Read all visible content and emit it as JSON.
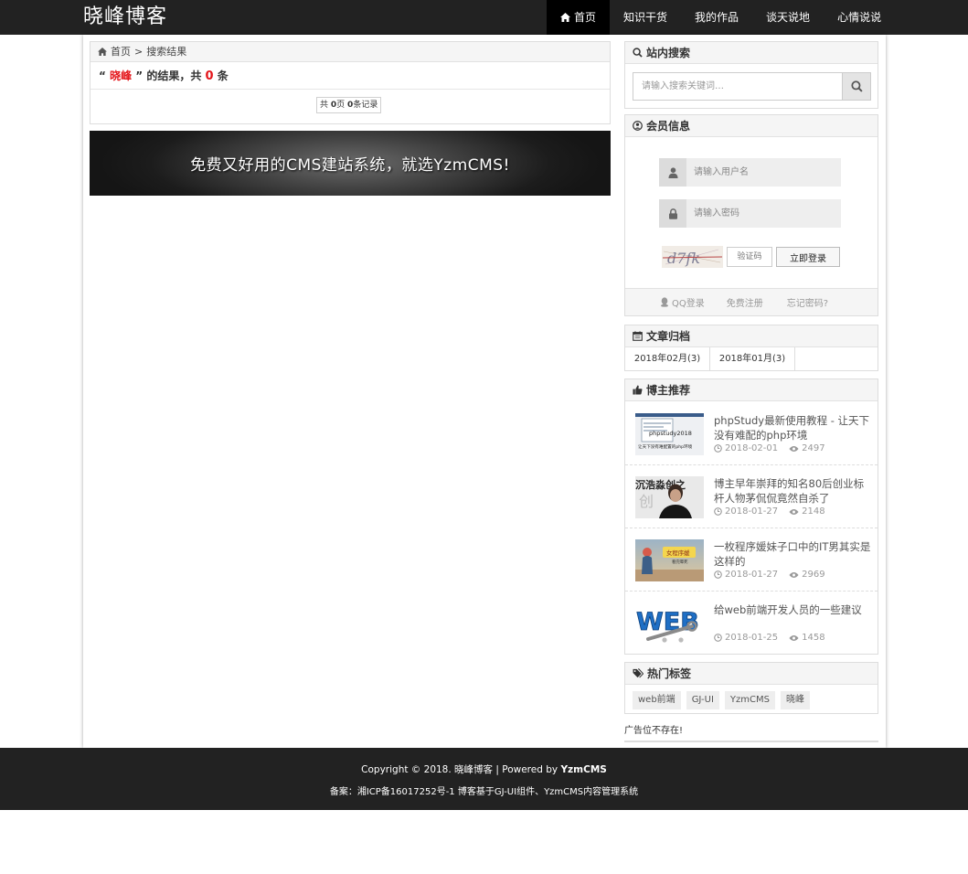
{
  "header": {
    "logo": "晓峰博客",
    "nav": [
      {
        "label": "首页",
        "active": true
      },
      {
        "label": "知识干货",
        "active": false
      },
      {
        "label": "我的作品",
        "active": false
      },
      {
        "label": "谈天说地",
        "active": false
      },
      {
        "label": "心情说说",
        "active": false
      }
    ]
  },
  "breadcrumb": {
    "home": "首页",
    "separator": ">",
    "current": "搜索结果"
  },
  "result": {
    "open_quote": "“",
    "keyword": "晓峰",
    "close_quote": "”",
    "text": " 的结果，共",
    "count": "0",
    "unit": "条"
  },
  "pager": {
    "prefix": "共",
    "pages": "0",
    "mid": "页",
    "records": "0",
    "suffix": "条记录"
  },
  "banner": {
    "text": "免费又好用的CMS建站系统，就选YzmCMS!"
  },
  "site_search": {
    "title": "站内搜索",
    "placeholder": "请输入搜索关键词…"
  },
  "member": {
    "title": "会员信息",
    "username_placeholder": "请输入用户名",
    "password_placeholder": "请输入密码",
    "captcha_placeholder": "验证码",
    "captcha_text": "d7fk",
    "login_label": "立即登录",
    "qq_login": "QQ登录",
    "register": "免费注册",
    "forgot": "忘记密码?"
  },
  "archive": {
    "title": "文章归档",
    "items": [
      "2018年02月(3)",
      "2018年01月(3)"
    ]
  },
  "recommend": {
    "title": "博主推荐",
    "items": [
      {
        "title": "phpStudy最新使用教程 - 让天下没有难配的php环境",
        "date": "2018-02-01",
        "views": "2497",
        "thumb_text": "phpstudy2018",
        "thumb_sub": "让天下没有难配置的php环境"
      },
      {
        "title": "博主早年崇拜的知名80后创业标杆人物茅侃侃竟然自杀了",
        "date": "2018-01-27",
        "views": "2148",
        "thumb_text": "沉浩淼创之",
        "thumb_sub": "创"
      },
      {
        "title": "一枚程序媛妹子口中的IT男其实是这样的",
        "date": "2018-01-27",
        "views": "2969",
        "thumb_text": "女程序媛",
        "thumb_sub": "看完晕死"
      },
      {
        "title": "给web前端开发人员的一些建议",
        "date": "2018-01-25",
        "views": "1458",
        "thumb_text": "WEB",
        "thumb_sub": ""
      }
    ]
  },
  "tags": {
    "title": "热门标签",
    "items": [
      "web前端",
      "GJ-UI",
      "YzmCMS",
      "晓峰"
    ]
  },
  "ad": {
    "text": "广告位不存在!"
  },
  "footer": {
    "copyright": "Copyright © 2018. 晓峰博客 | Powered by",
    "powered": "YzmCMS",
    "icp": "备案：湘ICP备16017252号-1 博客基于GJ-UI组件、YzmCMS内容管理系统"
  },
  "colors": {
    "header_bg": "#222222",
    "active_nav": "#000000",
    "highlight": "#e4161b",
    "panel_head": "#f5f5f5"
  }
}
